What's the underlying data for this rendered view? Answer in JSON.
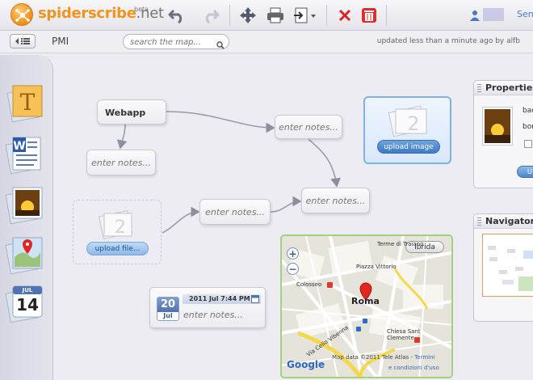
{
  "app": {
    "logo": "spiderscribe.net",
    "beta": "beta"
  },
  "toolbar": {
    "undo": "undo-icon",
    "redo": "redo-icon",
    "move": "move-icon",
    "print": "print-icon",
    "export": "export-icon",
    "delete": "delete-icon",
    "trash": "trash-icon",
    "send_label": "Send"
  },
  "subbar": {
    "map_title": "PMI",
    "search_placeholder": "search the map...",
    "updated_text": "updated less than a minute ago by alfb"
  },
  "dock": {
    "items": [
      "text-tool-icon",
      "document-tool-icon",
      "image-tool-icon",
      "map-tool-icon",
      "calendar-tool-icon"
    ],
    "calendar_month": "JUL",
    "calendar_day": "14"
  },
  "nodes": {
    "webapp": "Webapp",
    "notes_placeholder": "enter notes..."
  },
  "file_zone": {
    "button": "upload file..."
  },
  "image_zone": {
    "button": "upload image"
  },
  "date_node": {
    "day": "20",
    "month": "Jul",
    "datetime": "2011 Jul 7:44 PM",
    "notes": "enter notes..."
  },
  "map": {
    "ibrida": "Ibrida",
    "zoom_in": "+",
    "zoom_out": "−",
    "city": "Roma",
    "labels": [
      "Colosseo",
      "Chiesa Sant Clemente",
      "Via Celio Vibenna",
      "Piazza Vittorio",
      "Terme di Traiano"
    ],
    "footer_data": "Map data ©2011 Tele Atlas - ",
    "footer_terms": "Termini",
    "footer_conditions": "e condizioni d'uso",
    "google": "Google"
  },
  "properties": {
    "title": "Properties",
    "text_1": "bac",
    "text_2": "bor",
    "button": "U"
  },
  "navigator": {
    "title": "Navigator"
  }
}
